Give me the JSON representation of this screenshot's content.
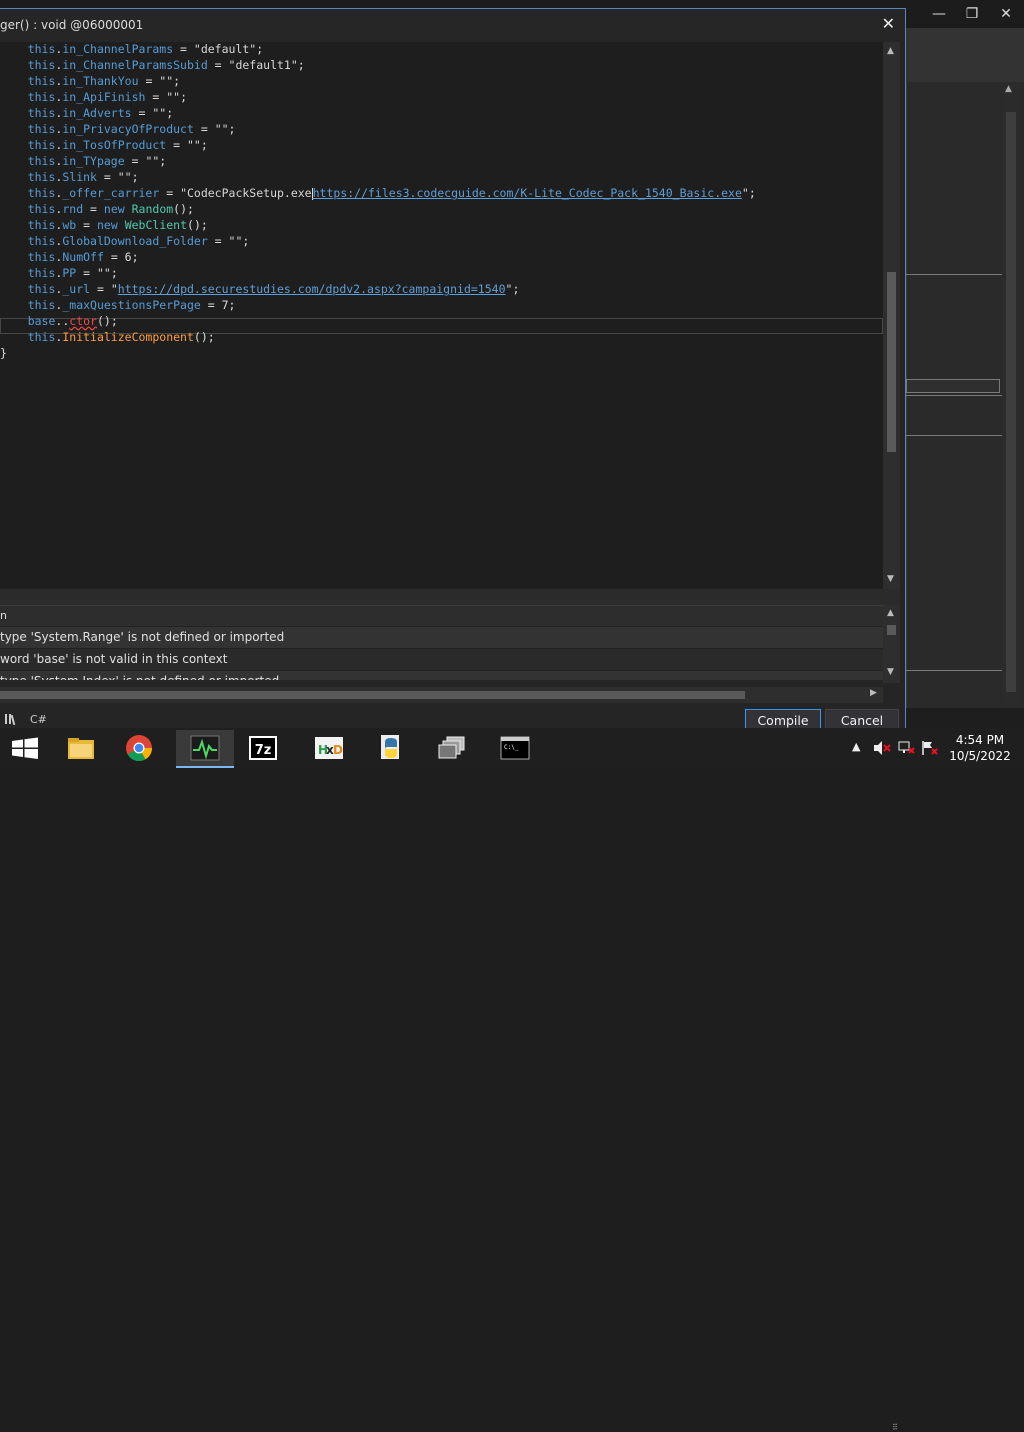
{
  "background_window": {
    "controls": [
      "—",
      "❐",
      "✕"
    ]
  },
  "dialog": {
    "title": "ger() : void @06000001",
    "close_label": "✕",
    "code_lines": [
      [
        {
          "c": "mem",
          "t": "this"
        },
        {
          "c": "",
          "t": "."
        },
        {
          "c": "mem",
          "t": "in_ChannelParams"
        },
        {
          "c": "",
          "t": " = "
        },
        {
          "c": "str",
          "t": "\"default\""
        },
        {
          "c": "",
          "t": ";"
        }
      ],
      [
        {
          "c": "mem",
          "t": "this"
        },
        {
          "c": "",
          "t": "."
        },
        {
          "c": "mem",
          "t": "in_ChannelParamsSubid"
        },
        {
          "c": "",
          "t": " = "
        },
        {
          "c": "str",
          "t": "\"default1\""
        },
        {
          "c": "",
          "t": ";"
        }
      ],
      [
        {
          "c": "mem",
          "t": "this"
        },
        {
          "c": "",
          "t": "."
        },
        {
          "c": "mem",
          "t": "in_ThankYou"
        },
        {
          "c": "",
          "t": " = "
        },
        {
          "c": "str",
          "t": "\"\""
        },
        {
          "c": "",
          "t": ";"
        }
      ],
      [
        {
          "c": "mem",
          "t": "this"
        },
        {
          "c": "",
          "t": "."
        },
        {
          "c": "mem",
          "t": "in_ApiFinish"
        },
        {
          "c": "",
          "t": " = "
        },
        {
          "c": "str",
          "t": "\"\""
        },
        {
          "c": "",
          "t": ";"
        }
      ],
      [
        {
          "c": "mem",
          "t": "this"
        },
        {
          "c": "",
          "t": "."
        },
        {
          "c": "mem",
          "t": "in_Adverts"
        },
        {
          "c": "",
          "t": " = "
        },
        {
          "c": "str",
          "t": "\"\""
        },
        {
          "c": "",
          "t": ";"
        }
      ],
      [
        {
          "c": "mem",
          "t": "this"
        },
        {
          "c": "",
          "t": "."
        },
        {
          "c": "mem",
          "t": "in_PrivacyOfProduct"
        },
        {
          "c": "",
          "t": " = "
        },
        {
          "c": "str",
          "t": "\"\""
        },
        {
          "c": "",
          "t": ";"
        }
      ],
      [
        {
          "c": "mem",
          "t": "this"
        },
        {
          "c": "",
          "t": "."
        },
        {
          "c": "mem",
          "t": "in_TosOfProduct"
        },
        {
          "c": "",
          "t": " = "
        },
        {
          "c": "str",
          "t": "\"\""
        },
        {
          "c": "",
          "t": ";"
        }
      ],
      [
        {
          "c": "mem",
          "t": "this"
        },
        {
          "c": "",
          "t": "."
        },
        {
          "c": "mem",
          "t": "in_TYpage"
        },
        {
          "c": "",
          "t": " = "
        },
        {
          "c": "str",
          "t": "\"\""
        },
        {
          "c": "",
          "t": ";"
        }
      ],
      [
        {
          "c": "mem",
          "t": "this"
        },
        {
          "c": "",
          "t": "."
        },
        {
          "c": "mem",
          "t": "Slink"
        },
        {
          "c": "",
          "t": " = "
        },
        {
          "c": "str",
          "t": "\"\""
        },
        {
          "c": "",
          "t": ";"
        }
      ],
      [
        {
          "c": "mem",
          "t": "this"
        },
        {
          "c": "",
          "t": "."
        },
        {
          "c": "mem",
          "t": "_offer_carrier"
        },
        {
          "c": "",
          "t": " = "
        },
        {
          "c": "str",
          "t": "\"CodecPackSetup.exe"
        },
        {
          "c": "caret",
          "t": ""
        },
        {
          "c": "lnk",
          "t": "https://files3.codecguide.com/K-Lite_Codec_Pack_1540_Basic.exe"
        },
        {
          "c": "str",
          "t": "\""
        },
        {
          "c": "",
          "t": ";"
        }
      ],
      [
        {
          "c": "mem",
          "t": "this"
        },
        {
          "c": "",
          "t": "."
        },
        {
          "c": "mem",
          "t": "rnd"
        },
        {
          "c": "",
          "t": " = "
        },
        {
          "c": "kw",
          "t": "new"
        },
        {
          "c": "",
          "t": " "
        },
        {
          "c": "typ",
          "t": "Random"
        },
        {
          "c": "",
          "t": "();"
        }
      ],
      [
        {
          "c": "mem",
          "t": "this"
        },
        {
          "c": "",
          "t": "."
        },
        {
          "c": "mem",
          "t": "wb"
        },
        {
          "c": "",
          "t": " = "
        },
        {
          "c": "kw",
          "t": "new"
        },
        {
          "c": "",
          "t": " "
        },
        {
          "c": "typ",
          "t": "WebClient"
        },
        {
          "c": "",
          "t": "();"
        }
      ],
      [
        {
          "c": "mem",
          "t": "this"
        },
        {
          "c": "",
          "t": "."
        },
        {
          "c": "mem",
          "t": "GlobalDownload_Folder"
        },
        {
          "c": "",
          "t": " = "
        },
        {
          "c": "str",
          "t": "\"\""
        },
        {
          "c": "",
          "t": ";"
        }
      ],
      [
        {
          "c": "mem",
          "t": "this"
        },
        {
          "c": "",
          "t": "."
        },
        {
          "c": "mem",
          "t": "NumOff"
        },
        {
          "c": "",
          "t": " = 6;"
        }
      ],
      [
        {
          "c": "mem",
          "t": "this"
        },
        {
          "c": "",
          "t": "."
        },
        {
          "c": "mem",
          "t": "PP"
        },
        {
          "c": "",
          "t": " = "
        },
        {
          "c": "str",
          "t": "\"\""
        },
        {
          "c": "",
          "t": ";"
        }
      ],
      [
        {
          "c": "mem",
          "t": "this"
        },
        {
          "c": "",
          "t": "."
        },
        {
          "c": "mem",
          "t": "_url"
        },
        {
          "c": "",
          "t": " = "
        },
        {
          "c": "str",
          "t": "\""
        },
        {
          "c": "lnk",
          "t": "https://dpd.securestudies.com/dpdv2.aspx?campaignid=1540"
        },
        {
          "c": "str",
          "t": "\""
        },
        {
          "c": "",
          "t": ";"
        }
      ],
      [
        {
          "c": "mem",
          "t": "this"
        },
        {
          "c": "",
          "t": "."
        },
        {
          "c": "mem",
          "t": "_maxQuestionsPerPage"
        },
        {
          "c": "",
          "t": " = 7;"
        }
      ],
      [
        {
          "c": "kw",
          "t": "base"
        },
        {
          "c": "",
          "t": ".."
        },
        {
          "c": "err",
          "t": "ctor"
        },
        {
          "c": "",
          "t": "();"
        }
      ],
      [
        {
          "c": "mem",
          "t": "this"
        },
        {
          "c": "",
          "t": "."
        },
        {
          "c": "meth",
          "t": "InitializeComponent"
        },
        {
          "c": "",
          "t": "();"
        }
      ],
      [
        {
          "c": "",
          "t": "}"
        }
      ]
    ],
    "error_header": "n",
    "errors": [
      "type 'System.Range' is not defined or imported",
      "word 'base' is not valid in this context",
      "type 'System.Index' is not defined or imported"
    ],
    "language_label": "C#",
    "compile_label": "Compile",
    "cancel_label": "Cancel"
  },
  "taskbar": {
    "apps": [
      "start",
      "file-explorer",
      "chrome",
      "performance-monitor",
      "7-zip",
      "hxd",
      "python",
      "task-view",
      "cmd"
    ],
    "time": "4:54 PM",
    "date": "10/5/2022"
  }
}
